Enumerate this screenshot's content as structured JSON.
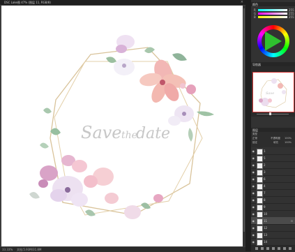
{
  "document": {
    "title": "DSC Lake图 47% (图层 11, RGB/8)",
    "zoom": "33.33%",
    "info": "文档:5.93M/31.8M"
  },
  "artwork": {
    "text_main": "Save",
    "text_the": "the",
    "text_date": "date"
  },
  "panels": {
    "color": {
      "tab": "颜色",
      "sliders": [
        {
          "label": "R",
          "value": "255"
        },
        {
          "label": "G",
          "value": "255"
        },
        {
          "label": "B",
          "value": "255"
        }
      ]
    },
    "navigator": {
      "tab": "导航器"
    },
    "layers": {
      "tab": "图层",
      "kind_label": "类型",
      "blend_mode": "正常",
      "opacity_label": "不透明度",
      "opacity": "100%",
      "lock_label": "锁定",
      "fill_label": "填充",
      "fill": "100%",
      "items": [
        {
          "name": "1"
        },
        {
          "name": "5"
        },
        {
          "name": "2"
        },
        {
          "name": "3"
        },
        {
          "name": "6"
        },
        {
          "name": "4"
        },
        {
          "name": "7"
        },
        {
          "name": "8"
        },
        {
          "name": "9"
        },
        {
          "name": "10"
        },
        {
          "name": "11"
        },
        {
          "name": "12"
        },
        {
          "name": "13"
        },
        {
          "name": "14"
        }
      ]
    }
  },
  "colors": {
    "accent": "#2fbf2f",
    "frame_gold": "#d9c39a",
    "nav_border": "#d83a3a"
  }
}
